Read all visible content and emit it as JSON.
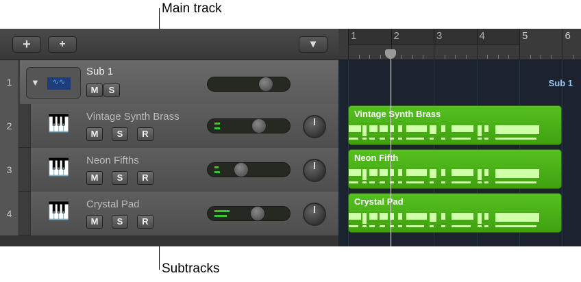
{
  "callouts": {
    "main": "Main track",
    "sub": "Subtracks"
  },
  "header": {
    "add": "+",
    "add_folder": "+",
    "dropdown": "▾"
  },
  "ruler": {
    "bars": [
      "1",
      "2",
      "3",
      "4",
      "5",
      "6"
    ]
  },
  "tracks": [
    {
      "number": "1",
      "name": "Sub 1",
      "buttons": [
        "M",
        "S"
      ],
      "icon": "audio-waveform-icon"
    },
    {
      "number": "2",
      "name": "Vintage Synth Brass",
      "buttons": [
        "M",
        "S",
        "R"
      ],
      "icon": "synth-icon"
    },
    {
      "number": "3",
      "name": "Neon Fifths",
      "buttons": [
        "M",
        "S",
        "R"
      ],
      "icon": "keyboard-icon"
    },
    {
      "number": "4",
      "name": "Crystal Pad",
      "buttons": [
        "M",
        "S",
        "R"
      ],
      "icon": "keyboard-icon"
    }
  ],
  "lane": {
    "summary_label": "Sub 1"
  },
  "regions": [
    "Vintage Synth Brass",
    "Neon Fifth",
    "Crystal Pad"
  ]
}
